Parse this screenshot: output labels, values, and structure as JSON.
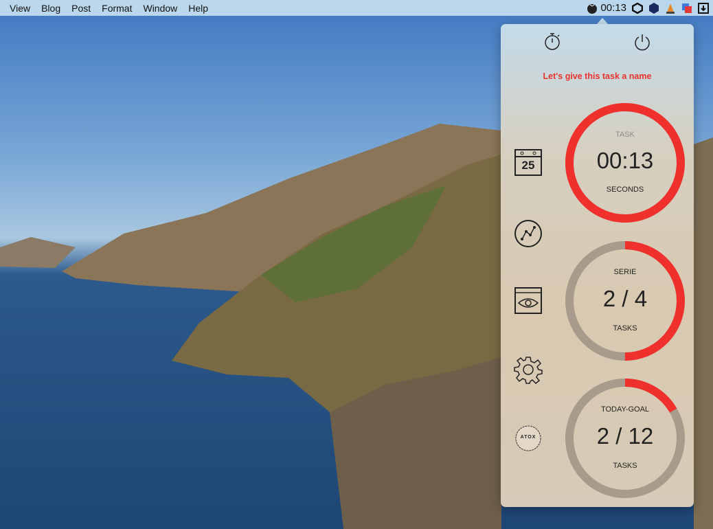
{
  "menubar": {
    "items": [
      "View",
      "Blog",
      "Post",
      "Format",
      "Window",
      "Help"
    ],
    "timer": "00:13"
  },
  "popup": {
    "task_name_prompt": "Let's give this task a name",
    "calendar_day": "25",
    "badge_text": "ATOX",
    "rings": [
      {
        "label": "TASK",
        "value": "00:13",
        "unit": "SECONDS",
        "progress": 1.0
      },
      {
        "label": "SERIE",
        "value": "2 / 4",
        "unit": "TASKS",
        "progress": 0.5
      },
      {
        "label": "TODAY-GOAL",
        "value": "2 / 12",
        "unit": "TASKS",
        "progress": 0.1667
      }
    ]
  },
  "colors": {
    "accent": "#f0302d",
    "track": "#a89b8b"
  }
}
